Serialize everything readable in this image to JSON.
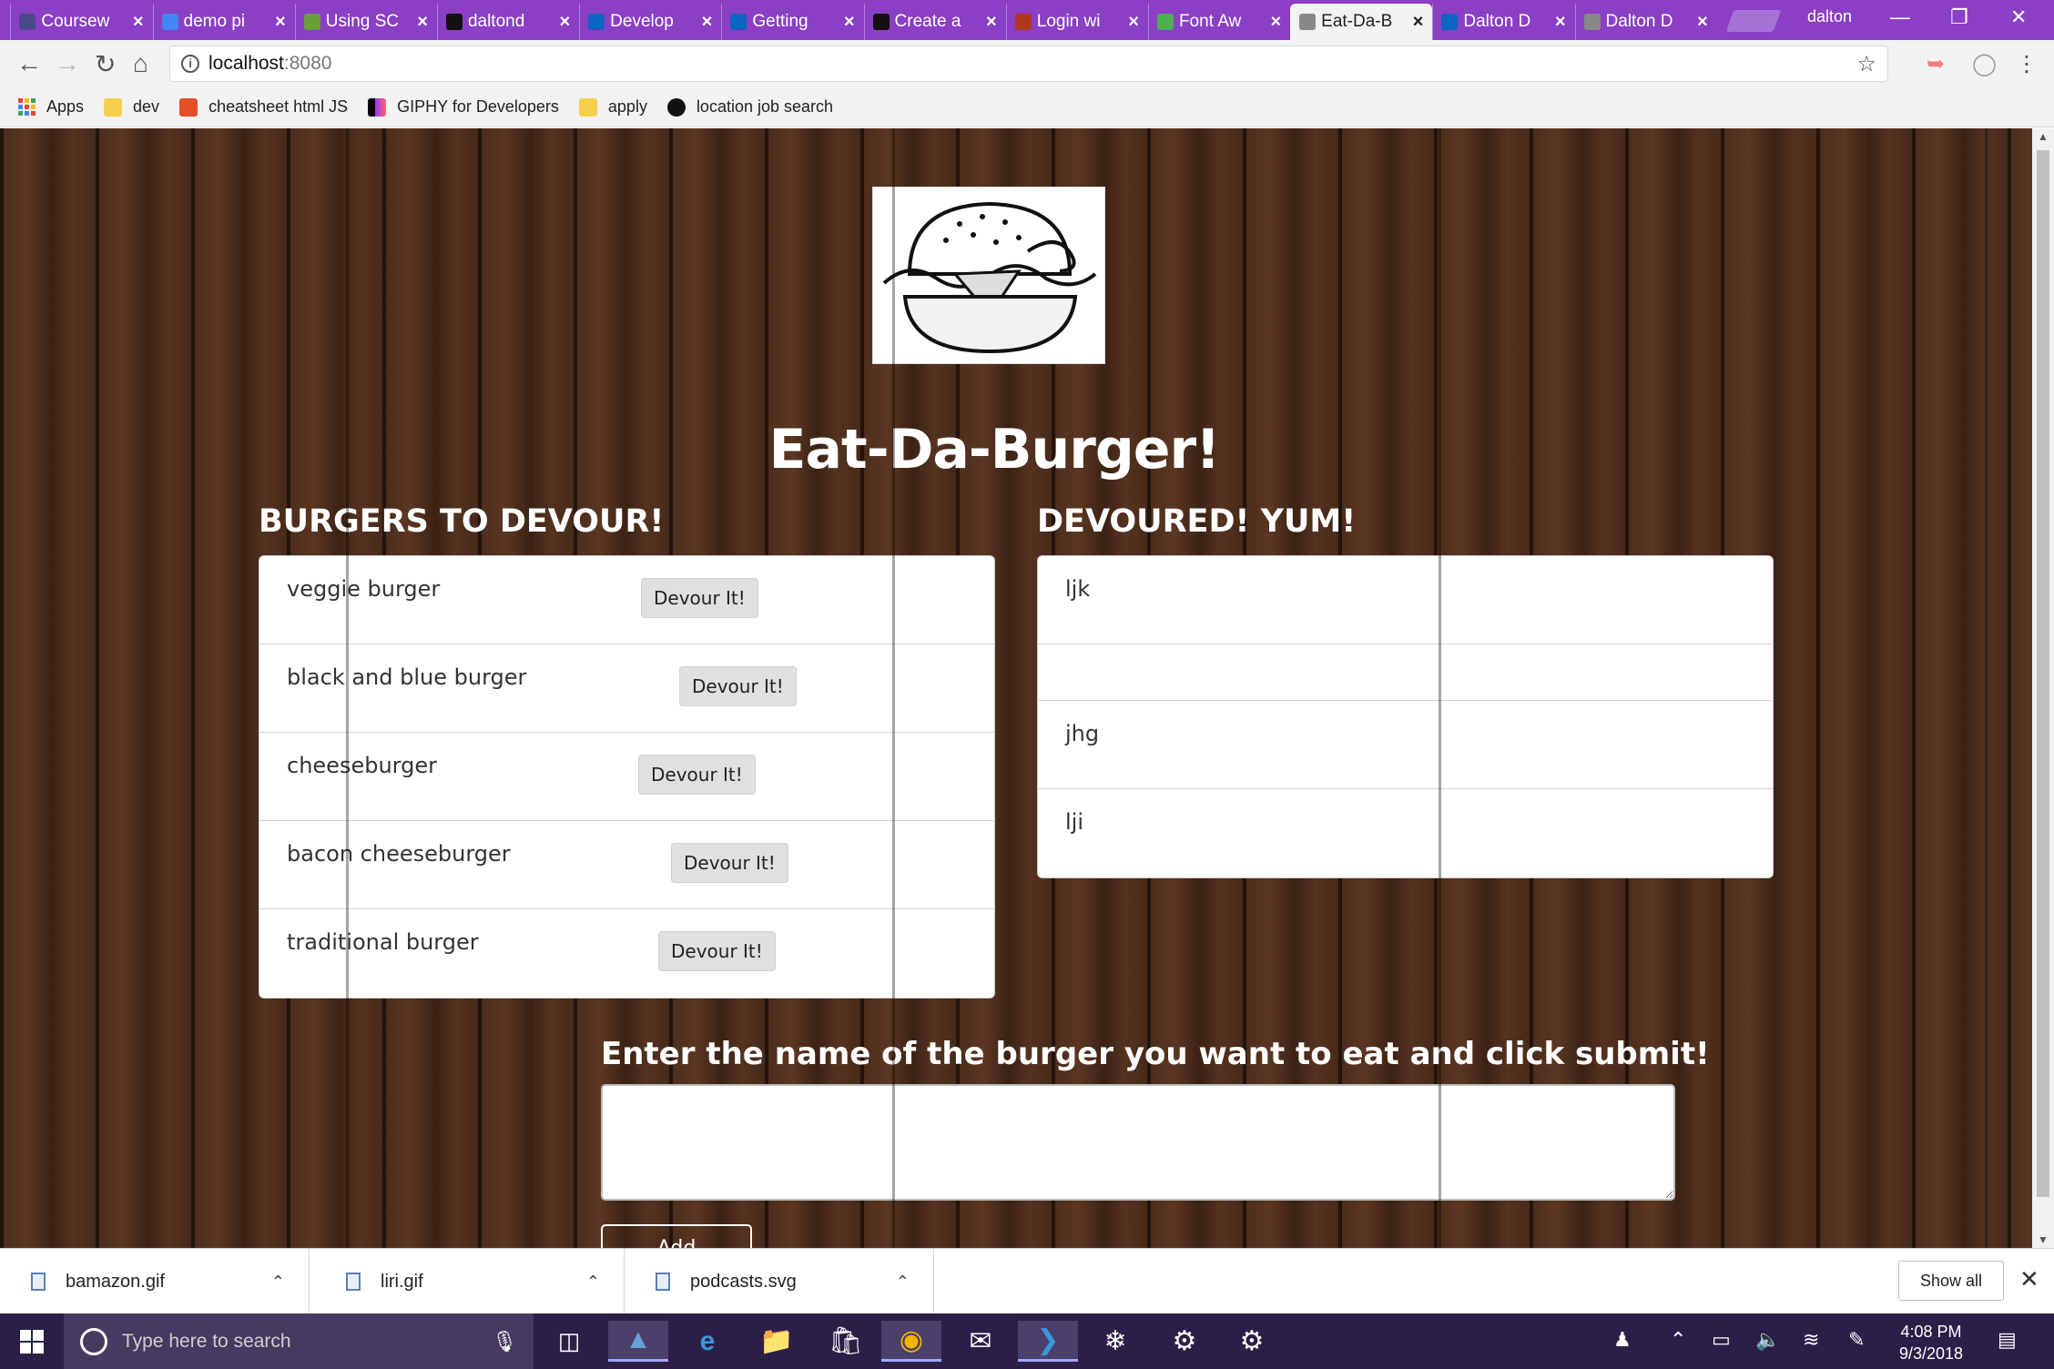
{
  "browser": {
    "tabs": [
      {
        "title": "Coursew",
        "favicon": "shield-icon",
        "color": "#4a4a8a"
      },
      {
        "title": "demo pi",
        "favicon": "google-icon",
        "color": "#4285f4"
      },
      {
        "title": "Using SC",
        "favicon": "puzzle-icon",
        "color": "#6b9e3a"
      },
      {
        "title": "daltond",
        "favicon": "github-icon",
        "color": "#111111"
      },
      {
        "title": "Develop",
        "favicon": "linkedin-icon",
        "color": "#0a66c2"
      },
      {
        "title": "Getting",
        "favicon": "linkedin-icon",
        "color": "#0a66c2"
      },
      {
        "title": "Create a",
        "favicon": "github-icon",
        "color": "#111111"
      },
      {
        "title": "Login wi",
        "favicon": "codewars-icon",
        "color": "#b1361e"
      },
      {
        "title": "Font Aw",
        "favicon": "w3-icon",
        "color": "#4caf50"
      },
      {
        "title": "Eat-Da-B",
        "favicon": "page-icon",
        "color": "#888888"
      },
      {
        "title": "Dalton D",
        "favicon": "linkedin-icon",
        "color": "#0a66c2"
      },
      {
        "title": "Dalton D",
        "favicon": "page-icon",
        "color": "#888888"
      }
    ],
    "user": "dalton",
    "url_host": "localhost",
    "url_port": ":8080",
    "bookmarks": [
      {
        "label": "Apps",
        "icon": "apps-grid-icon"
      },
      {
        "label": "dev",
        "icon": "folder-icon"
      },
      {
        "label": "cheatsheet html JS",
        "icon": "html5-icon"
      },
      {
        "label": "GIPHY for Developers",
        "icon": "giphy-icon"
      },
      {
        "label": "apply",
        "icon": "folder-icon"
      },
      {
        "label": "location job search",
        "icon": "github-icon"
      }
    ]
  },
  "page": {
    "title": "Eat-Da-Burger!",
    "to_devour_heading": "BURGERS TO DEVOUR!",
    "devoured_heading": "DEVOURED! YUM!",
    "devour_button_label": "Devour It!",
    "to_devour": [
      "veggie burger",
      "black and blue burger",
      "cheeseburger",
      "bacon cheeseburger",
      "traditional burger"
    ],
    "devoured": [
      "ljk",
      "",
      "jhg",
      "lji"
    ],
    "form_label": "Enter the name of the burger you want to eat and click submit!",
    "input_value": "",
    "add_button_label": "Add Burger!"
  },
  "downloads": {
    "items": [
      "bamazon.gif",
      "liri.gif",
      "podcasts.svg"
    ],
    "show_all": "Show all"
  },
  "taskbar": {
    "search_placeholder": "Type here to search",
    "time": "4:08 PM",
    "date": "9/3/2018"
  }
}
